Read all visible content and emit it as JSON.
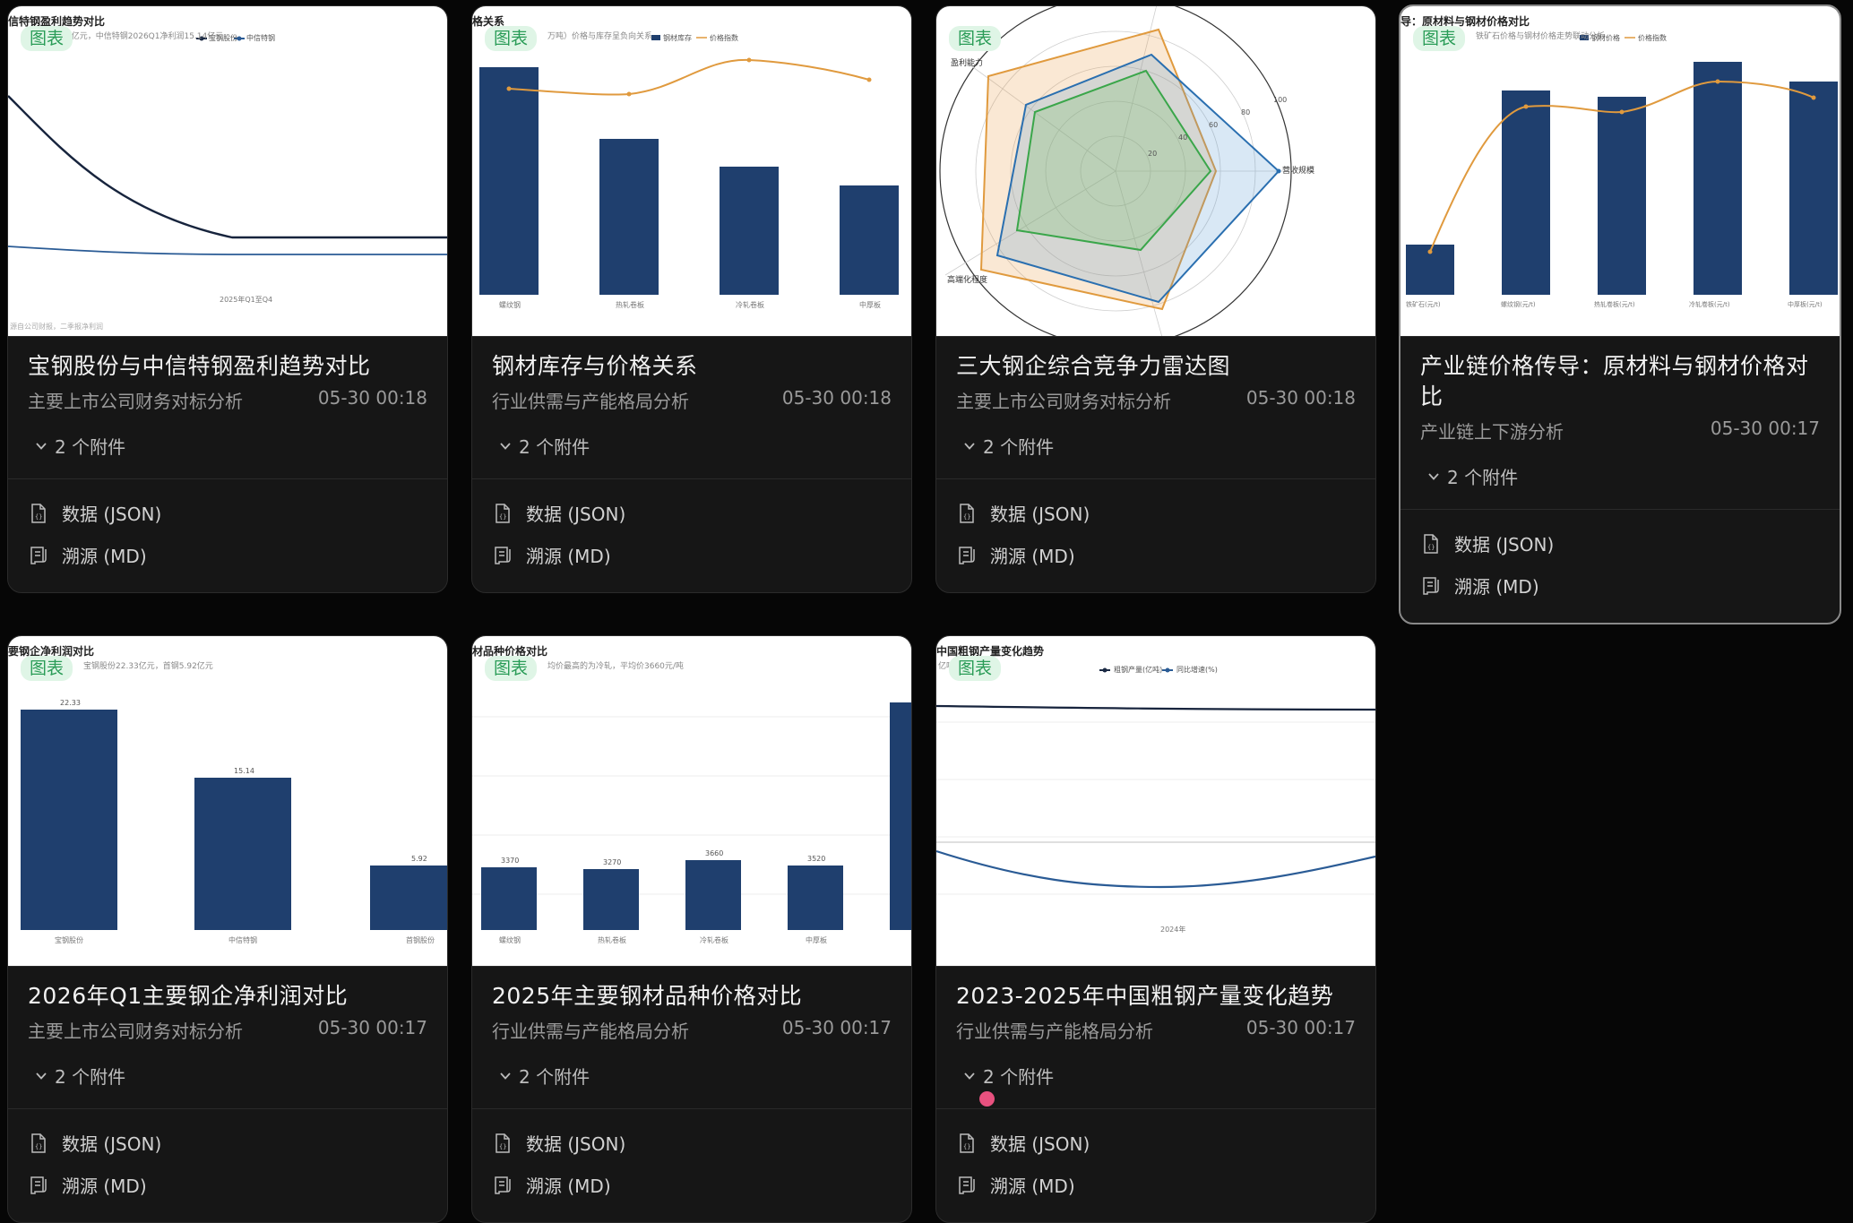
{
  "colors": {
    "background": "#060606",
    "card": "#161616",
    "tag_bg": "#dff5e6",
    "tag_text": "#2a9c57",
    "bar": "#1f3f6e",
    "line_orange": "#e09a3e",
    "radar_blue": "#2a6fb0",
    "radar_green": "#3aa64a",
    "pink_dot": "#e8517f"
  },
  "icons": {
    "chevron": "chevron-down-icon",
    "json_file": "json-file-icon",
    "md_file": "md-file-icon"
  },
  "common": {
    "tag": "图表",
    "attachments": "2 个附件",
    "file_json": "数据 (JSON)",
    "file_md": "溯源 (MD)"
  },
  "cards": [
    {
      "title": "宝钢股份与中信特钢盈利趋势对比",
      "category": "主要上市公司财务对标分析",
      "time": "05-30 00:18",
      "thumb": {
        "title": "信特钢盈利趋势对比",
        "sub": "净利润22.33亿元，中信特钢2026Q1净利润15.14亿元",
        "legend": [
          "宝钢股份",
          "中信特钢"
        ],
        "xlabel": "2025年Q1至Q4",
        "foot": "源自公司财报，二季报净利润"
      }
    },
    {
      "title": "钢材库存与价格关系",
      "category": "行业供需与产能格局分析",
      "time": "05-30 00:18",
      "thumb": {
        "title": "格关系",
        "sub": "万吨）价格与库存呈负向关系",
        "legend": [
          "钢材库存",
          "价格指数"
        ],
        "categories": [
          "螺纹钢",
          "热轧卷板",
          "冷轧卷板",
          "中厚板"
        ]
      }
    },
    {
      "title": "三大钢企综合竞争力雷达图",
      "category": "主要上市公司财务对标分析",
      "time": "05-30 00:18",
      "thumb": {
        "axes": [
          "盈利能力",
          "营收规模",
          "高端化程度"
        ],
        "ticks": [
          "20",
          "40",
          "60",
          "80",
          "100"
        ]
      }
    },
    {
      "title": "产业链价格传导：原材料与钢材价格对比",
      "category": "产业链上下游分析",
      "time": "05-30 00:17",
      "selected": true,
      "thumb": {
        "title": "导：原材料与钢材价格对比",
        "sub": "铁矿石价格与钢材价格走势联动分析",
        "legend": [
          "钢材价格",
          "价格指数"
        ],
        "categories": [
          "铁矿石(元/t)",
          "螺纹钢(元/t)",
          "热轧卷板(元/t)",
          "冷轧卷板(元/t)",
          "中厚板(元/t)"
        ]
      }
    },
    {
      "title": "2026年Q1主要钢企净利润对比",
      "category": "主要上市公司财务对标分析",
      "time": "05-30 00:17",
      "thumb": {
        "title": "要钢企净利润对比",
        "sub": "宝钢股份22.33亿元，首钢5.92亿元",
        "bar_labels": [
          "22.33",
          "15.14",
          "5.92"
        ],
        "categories": [
          "宝钢股份",
          "中信特钢",
          "首钢股份"
        ]
      }
    },
    {
      "title": "2025年主要钢材品种价格对比",
      "category": "行业供需与产能格局分析",
      "time": "05-30 00:17",
      "thumb": {
        "title": "材品种价格对比",
        "sub": "均价最高的为冷轧，平均价3660元/吨",
        "bar_labels": [
          "3370",
          "3270",
          "3660",
          "3520"
        ],
        "categories": [
          "螺纹钢",
          "热轧卷板",
          "冷轧卷板",
          "中厚板"
        ]
      }
    },
    {
      "title": "2023-2025年中国粗钢产量变化趋势",
      "category": "行业供需与产能格局分析",
      "time": "05-30 00:17",
      "thumb": {
        "title": "中国粗钢产量变化趋势",
        "sub": "亿吨，同比变化",
        "legend": [
          "粗钢产量(亿吨)",
          "同比增速(%)"
        ],
        "xlabel": "2024年"
      }
    }
  ]
}
